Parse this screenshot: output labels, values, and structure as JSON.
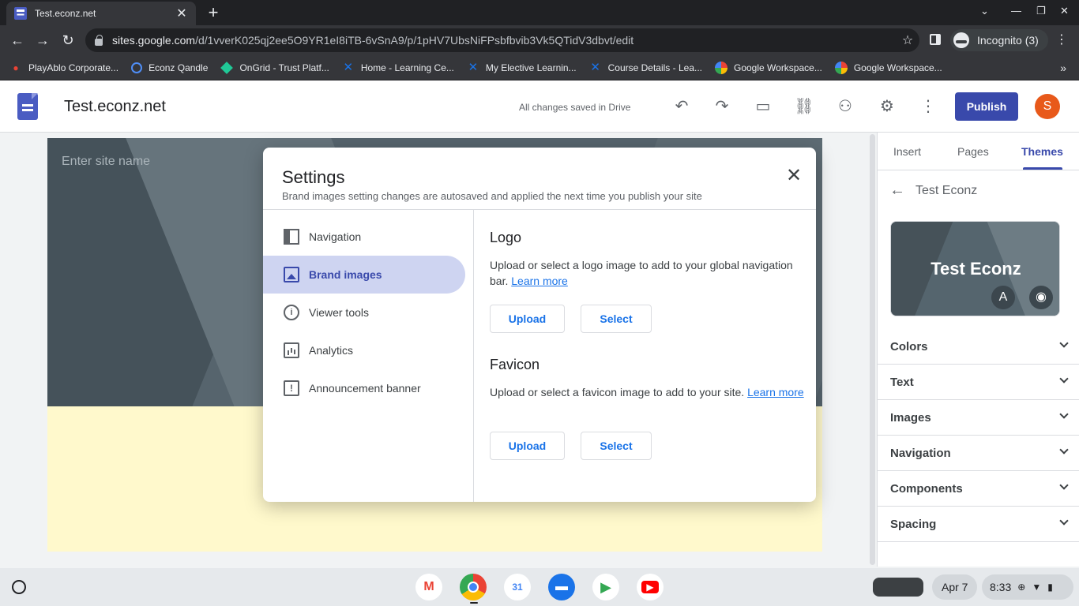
{
  "browser": {
    "tab_title": "Test.econz.net",
    "tab_close": "✕",
    "new_tab": "+",
    "url_host": "sites.google.com",
    "url_path": "/d/1vverK025qj2ee5O9YR1eI8iTB-6vSnA9/p/1pHV7UbsNiFPsbfbvib3Vk5QTidV3dbvt/edit",
    "profile": "Incognito (3)",
    "bookmarks": [
      {
        "icon": "map-pin-icon",
        "label": "PlayAblo Corporate..."
      },
      {
        "icon": "q-icon",
        "label": "Econz Qandle"
      },
      {
        "icon": "ongrid-icon",
        "label": "OnGrid - Trust Platf..."
      },
      {
        "icon": "x-icon",
        "label": "Home - Learning Ce..."
      },
      {
        "icon": "x-icon",
        "label": "My Elective Learnin..."
      },
      {
        "icon": "x-icon",
        "label": "Course Details - Lea..."
      },
      {
        "icon": "google-icon",
        "label": "Google Workspace..."
      },
      {
        "icon": "google-icon",
        "label": "Google Workspace..."
      }
    ],
    "bookmarks_more": "»"
  },
  "app": {
    "doc_title": "Test.econz.net",
    "saved_status": "All changes saved in Drive",
    "publish_label": "Publish",
    "avatar_letter": "S"
  },
  "canvas": {
    "site_name_placeholder": "Enter site name"
  },
  "settings": {
    "title": "Settings",
    "subtitle": "Brand images setting changes are autosaved and applied the next time you publish your site",
    "nav": [
      {
        "label": "Navigation",
        "icon": "navigation-icon",
        "active": false
      },
      {
        "label": "Brand images",
        "icon": "image-icon",
        "active": true
      },
      {
        "label": "Viewer tools",
        "icon": "info-icon",
        "active": false
      },
      {
        "label": "Analytics",
        "icon": "analytics-icon",
        "active": false
      },
      {
        "label": "Announcement banner",
        "icon": "announcement-icon",
        "active": false
      }
    ],
    "logo": {
      "title": "Logo",
      "text": "Upload or select a logo image to add to your global navigation bar.",
      "link": "Learn more",
      "upload": "Upload",
      "select": "Select"
    },
    "favicon": {
      "title": "Favicon",
      "text": "Upload or select a favicon image to add to your site.",
      "link": "Learn more",
      "upload": "Upload",
      "select": "Select"
    }
  },
  "panel": {
    "tabs": [
      "Insert",
      "Pages",
      "Themes"
    ],
    "active_tab": "Themes",
    "theme_name": "Test Econz",
    "card_title": "Test Econz",
    "sections": [
      "Colors",
      "Text",
      "Images",
      "Navigation",
      "Components",
      "Spacing"
    ]
  },
  "shelf": {
    "apps": [
      "gmail-icon",
      "chrome-icon",
      "calendar-icon",
      "files-icon",
      "play-store-icon",
      "youtube-icon"
    ],
    "calendar_day": "31",
    "date": "Apr 7",
    "time": "8:33"
  }
}
